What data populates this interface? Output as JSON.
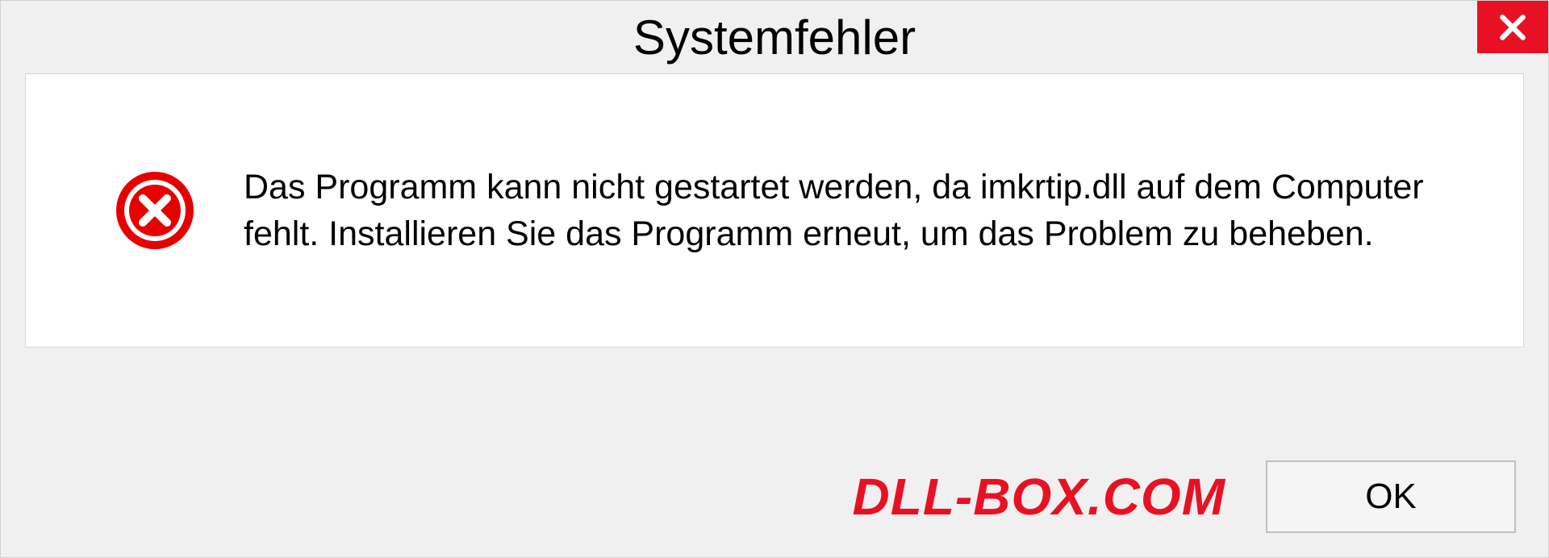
{
  "dialog": {
    "title": "Systemfehler",
    "message": "Das Programm kann nicht gestartet werden, da imkrtip.dll auf dem Computer fehlt. Installieren Sie das Programm erneut, um das Problem zu beheben.",
    "ok_label": "OK",
    "watermark": "DLL-BOX.COM"
  },
  "colors": {
    "error_red": "#e81123",
    "close_red": "#e81123"
  }
}
